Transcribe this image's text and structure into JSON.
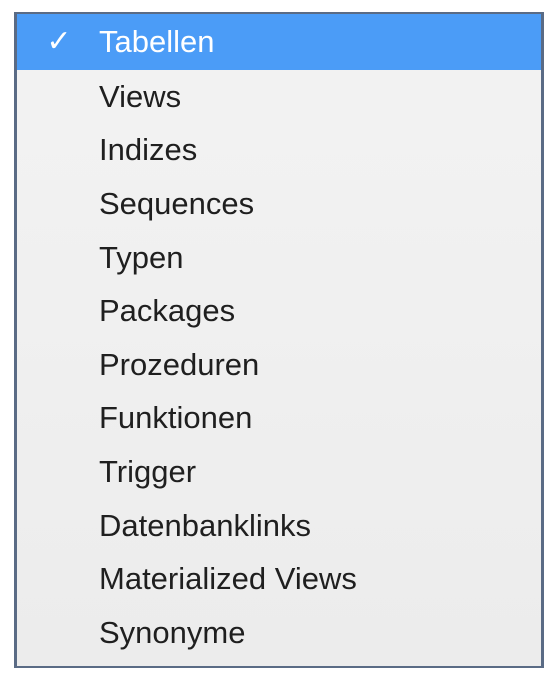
{
  "menu": {
    "checkmark": "✓",
    "items": [
      {
        "label": "Tabellen",
        "selected": true
      },
      {
        "label": "Views",
        "selected": false
      },
      {
        "label": "Indizes",
        "selected": false
      },
      {
        "label": "Sequences",
        "selected": false
      },
      {
        "label": "Typen",
        "selected": false
      },
      {
        "label": "Packages",
        "selected": false
      },
      {
        "label": "Prozeduren",
        "selected": false
      },
      {
        "label": "Funktionen",
        "selected": false
      },
      {
        "label": "Trigger",
        "selected": false
      },
      {
        "label": "Datenbanklinks",
        "selected": false
      },
      {
        "label": "Materialized Views",
        "selected": false
      },
      {
        "label": "Synonyme",
        "selected": false
      }
    ],
    "colors": {
      "selection": "#4b9cf7",
      "selected_text": "#ffffff",
      "text": "#1f1f1f",
      "background": "#efefef",
      "border": "#5a6b85"
    }
  }
}
